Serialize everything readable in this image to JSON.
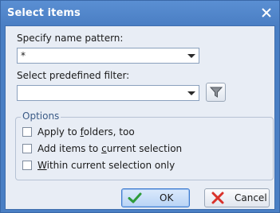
{
  "window": {
    "title": "Select items",
    "close_icon": "close-icon"
  },
  "name_pattern": {
    "label": "Specify name pattern:",
    "value": "*"
  },
  "predefined_filter": {
    "label": "Select predefined filter:",
    "value": "",
    "filter_icon": "funnel-icon"
  },
  "options": {
    "legend": "Options",
    "items": [
      {
        "pre": "Apply to ",
        "u": "f",
        "post": "olders, too",
        "checked": false
      },
      {
        "pre": "Add items to ",
        "u": "c",
        "post": "urrent selection",
        "checked": false
      },
      {
        "pre": "",
        "u": "W",
        "post": "ithin current selection only",
        "checked": false
      }
    ]
  },
  "buttons": {
    "ok": {
      "label": "OK",
      "icon": "checkmark-icon",
      "color": "#2e9b3a"
    },
    "cancel": {
      "label": "Cancel",
      "icon": "x-icon",
      "color": "#d9322b"
    }
  },
  "colors": {
    "titlebar": "#4b7fc4",
    "client_bg": "#e8edf5",
    "group_legend": "#3a5a86"
  }
}
